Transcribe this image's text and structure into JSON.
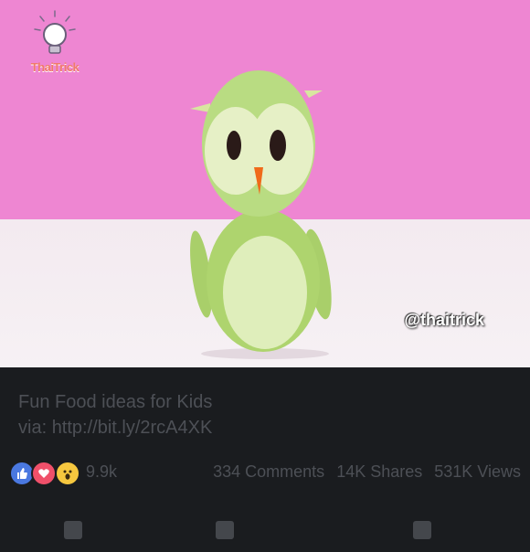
{
  "video": {
    "logo_text": "ThaiTrick",
    "watermark": "@thaitrick"
  },
  "post": {
    "title": "Fun Food ideas for Kids",
    "via_label": "via:",
    "link": "http://bit.ly/2rcA4XK"
  },
  "stats": {
    "reactions_count": "9.9k",
    "comments": "334 Comments",
    "shares": "14K Shares",
    "views": "531K Views"
  },
  "colors": {
    "wall": "#ee86d2",
    "table": "#f4eef2",
    "apple": "#b9dc82",
    "background": "#1a1c1f"
  }
}
